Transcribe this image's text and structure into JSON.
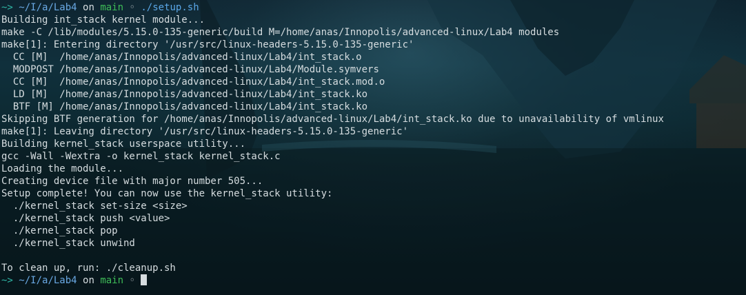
{
  "prompt_first": {
    "arrow": "~>",
    "path": "~/I/a/Lab4",
    "on": "on",
    "branch": "main",
    "mark": "◦",
    "command": "./setup.sh"
  },
  "output": [
    "Building int_stack kernel module...",
    "make -C /lib/modules/5.15.0-135-generic/build M=/home/anas/Innopolis/advanced-linux/Lab4 modules",
    "make[1]: Entering directory '/usr/src/linux-headers-5.15.0-135-generic'",
    "  CC [M]  /home/anas/Innopolis/advanced-linux/Lab4/int_stack.o",
    "  MODPOST /home/anas/Innopolis/advanced-linux/Lab4/Module.symvers",
    "  CC [M]  /home/anas/Innopolis/advanced-linux/Lab4/int_stack.mod.o",
    "  LD [M]  /home/anas/Innopolis/advanced-linux/Lab4/int_stack.ko",
    "  BTF [M] /home/anas/Innopolis/advanced-linux/Lab4/int_stack.ko",
    "Skipping BTF generation for /home/anas/Innopolis/advanced-linux/Lab4/int_stack.ko due to unavailability of vmlinux",
    "make[1]: Leaving directory '/usr/src/linux-headers-5.15.0-135-generic'",
    "Building kernel_stack userspace utility...",
    "gcc -Wall -Wextra -o kernel_stack kernel_stack.c",
    "Loading the module...",
    "Creating device file with major number 505...",
    "Setup complete! You can now use the kernel_stack utility:",
    "  ./kernel_stack set-size <size>",
    "  ./kernel_stack push <value>",
    "  ./kernel_stack pop",
    "  ./kernel_stack unwind",
    "",
    "To clean up, run: ./cleanup.sh"
  ],
  "prompt_last": {
    "arrow": "~>",
    "path": "~/I/a/Lab4",
    "on": "on",
    "branch": "main",
    "mark": "◦"
  }
}
